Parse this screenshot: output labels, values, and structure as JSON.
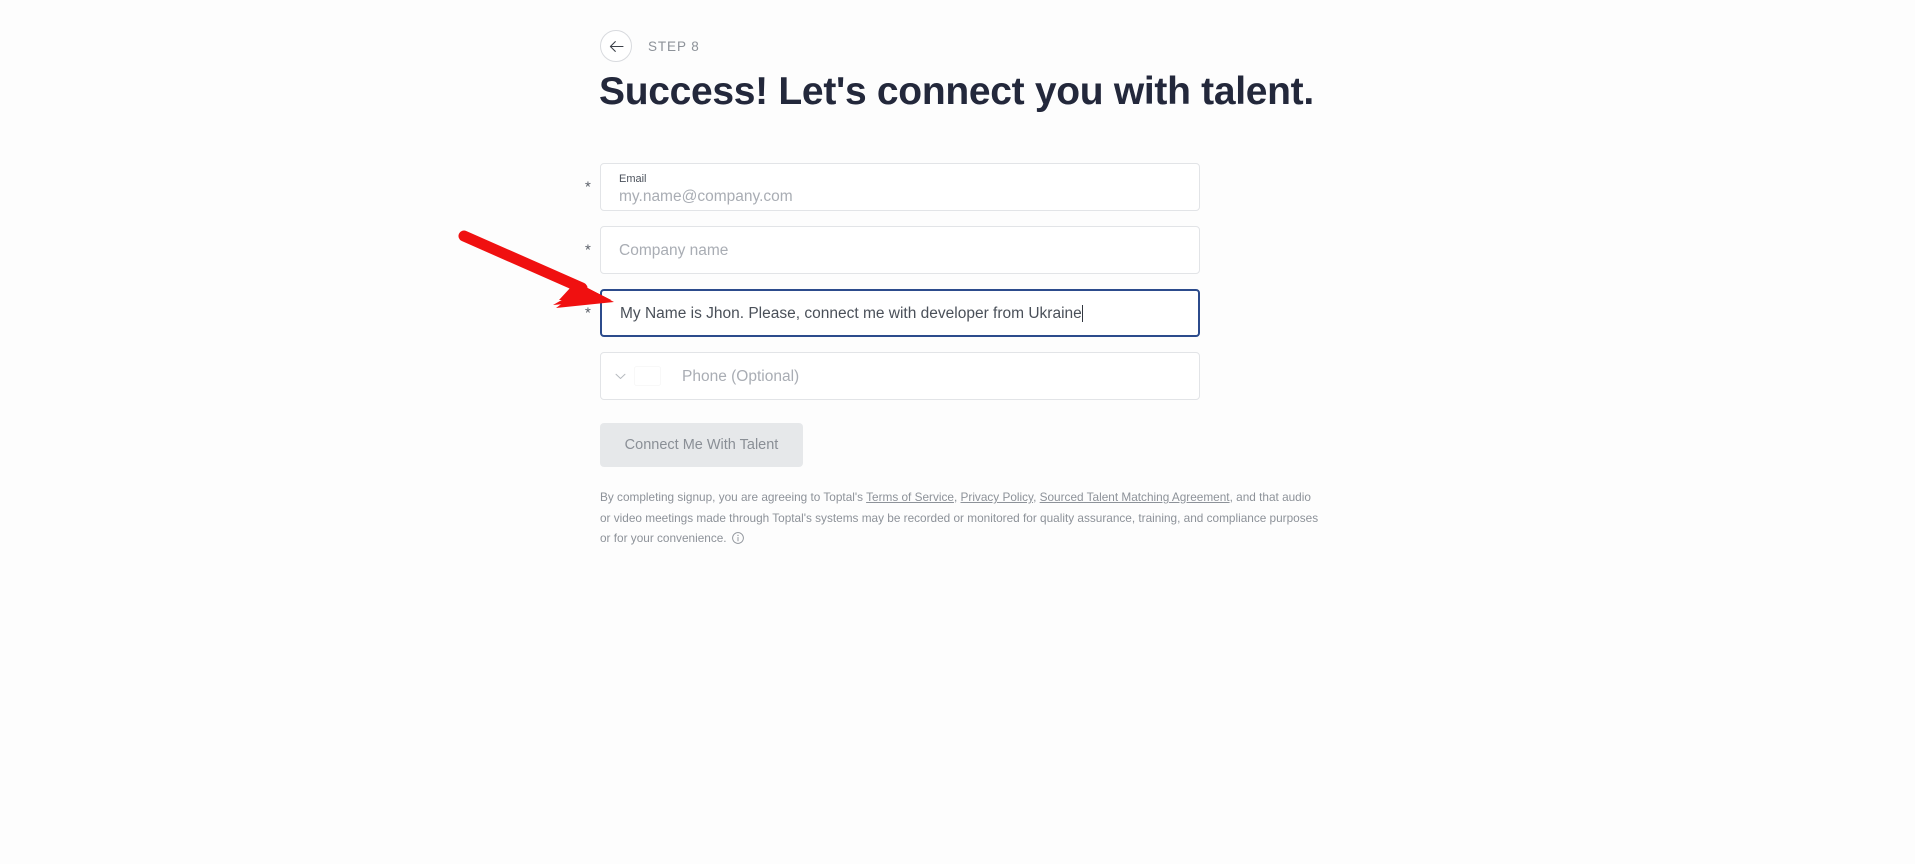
{
  "header": {
    "back_icon": "arrow-left-icon",
    "step_label": "STEP 8"
  },
  "title": "Success! Let's connect you with talent.",
  "form": {
    "required_marker": "*",
    "fields": [
      {
        "name": "email",
        "label": "Email",
        "placeholder": "my.name@company.com",
        "value": ""
      },
      {
        "name": "company-name",
        "label": "",
        "placeholder": "Company name",
        "value": ""
      },
      {
        "name": "message",
        "label": "",
        "placeholder": "",
        "value": "My Name is Jhon. Please, connect me with developer from Ukraine"
      },
      {
        "name": "phone",
        "label": "",
        "placeholder": "Phone (Optional)",
        "value": "",
        "country_flag": "ukraine-flag-icon",
        "dropdown_icon": "chevron-down-icon"
      }
    ]
  },
  "submit": {
    "label": "Connect Me With Talent",
    "disabled": true,
    "bg_color": "#e6e8ea",
    "text_color": "#8a8f96"
  },
  "legal": {
    "part1": "By completing signup, you are agreeing to Toptal's ",
    "link1": "Terms of Service",
    "sep1": ", ",
    "link2": "Privacy Policy",
    "sep2": ", ",
    "link3": "Sourced Talent Matching Agreement",
    "part2": ", and that audio or video meetings made through Toptal's systems may be recorded or monitored for quality assurance, training, and compliance purposes or for your convenience. ",
    "info_icon": "info-circle-icon"
  },
  "annotation": {
    "arrow_color": "#f01010",
    "arrow_name": "red-pointer-arrow"
  },
  "colors": {
    "background": "#fdfdfd",
    "title": "#23283b",
    "focus_border": "#2c4b8c",
    "field_border": "#e2e4e7",
    "placeholder": "#a9adb4",
    "muted_text": "#8d9299"
  }
}
